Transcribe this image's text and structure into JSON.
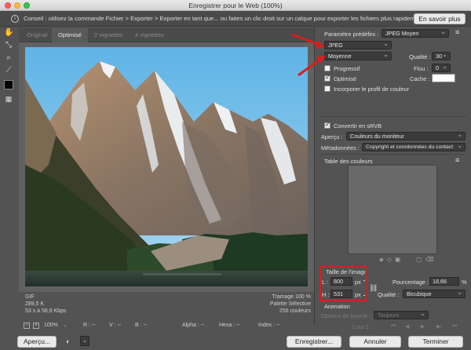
{
  "window": {
    "title": "Enregistrer pour le Web (100%)"
  },
  "infobar": {
    "message": "Conseil : utilisez la commande Fichier > Exporter > Exporter en tant que... ou faites un clic droit sur un calque pour exporter les fichiers plus rapidement.",
    "learn_more": "En savoir plus"
  },
  "tabs": [
    "Original",
    "Optimisé",
    "2 vignettes",
    "4 vignettes"
  ],
  "image_info": {
    "format": "GIF",
    "size": "289,5 K",
    "speed": "53 s à 56,6 Kbps",
    "dither": "Tramage 100 %",
    "palette": "Palette Sélective",
    "colors": "256 couleurs"
  },
  "status": {
    "zoom": "100%",
    "r": "R : --",
    "v": "V : --",
    "b": "B : --",
    "alpha": "Alpha : --",
    "hexa": "Hexa : --",
    "index": "Index : --"
  },
  "panel": {
    "preset_label": "Paramètre prédéfini :",
    "preset_value": "JPEG  Moyen",
    "format_value": "JPEG",
    "quality_preset": "Moyenne",
    "quality_label": "Qualité :",
    "quality_value": "30",
    "progressive": "Progressif",
    "blur_label": "Flou :",
    "blur_value": "0",
    "optimized": "Optimisé",
    "matte_label": "Cache :",
    "embed_profile": "Incorporer le profil de couleur",
    "convert_srgb": "Convertir en sRVB",
    "preview_label": "Aperçu :",
    "preview_value": "Couleurs du moniteur",
    "metadata_label": "Métadonnées :",
    "metadata_value": "Copyright et coordonnées du contact",
    "color_table": "Table des couleurs",
    "image_size": "Taille de l'image",
    "width_label": "L :",
    "width_value": "800",
    "height_label": "H :",
    "height_value": "531",
    "px": "px",
    "percent_label": "Pourcentage :",
    "percent_value": "18,66",
    "percent_unit": "%",
    "resample_label": "Qualité :",
    "resample_value": "Bicubique",
    "animation": "Animation",
    "loop_label": "Options de boucle :",
    "loop_value": "Toujours",
    "frame_counter": "1 sur 1"
  },
  "buttons": {
    "preview": "Aperçu...",
    "save": "Enregistrer...",
    "cancel": "Annuler",
    "done": "Terminer"
  }
}
